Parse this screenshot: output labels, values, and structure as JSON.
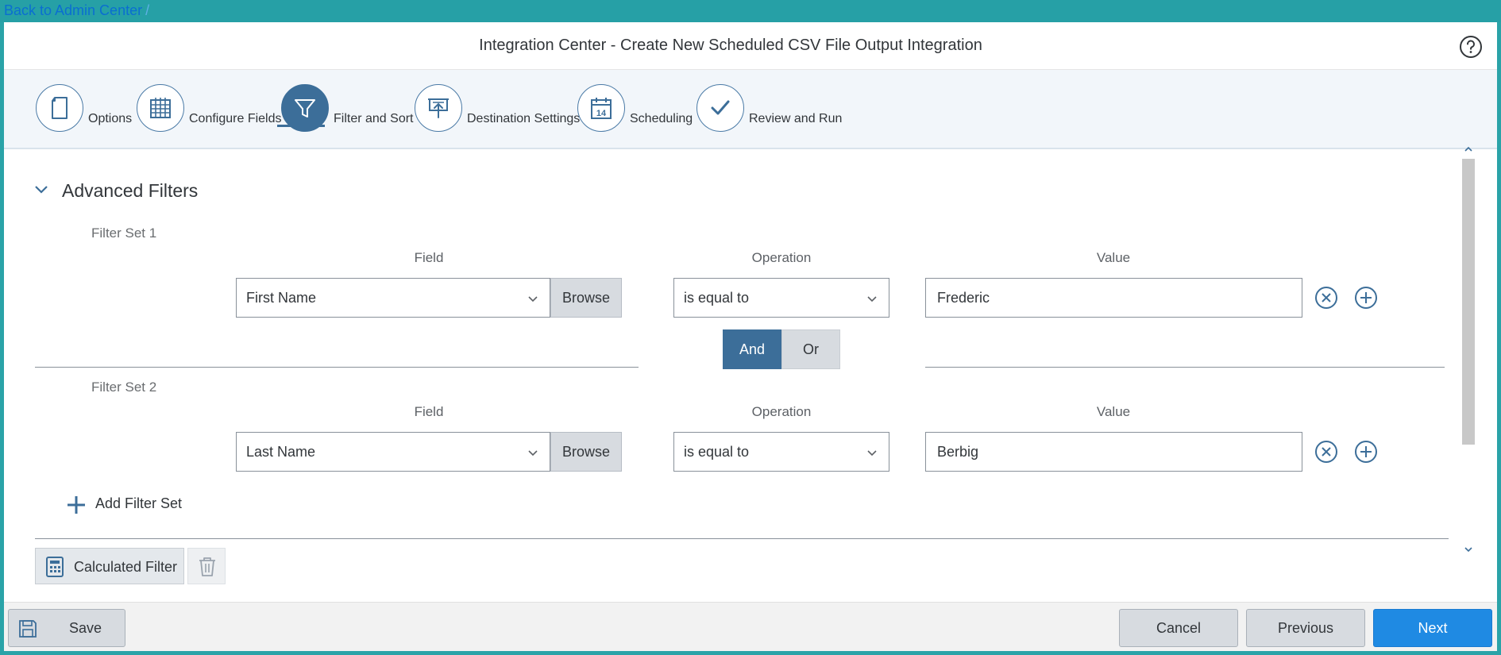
{
  "breadcrumb": {
    "back_label": "Back to Admin Center",
    "separator": "/"
  },
  "header": {
    "title": "Integration Center - Create New Scheduled CSV File Output Integration"
  },
  "steps": [
    {
      "label": "Options",
      "icon": "document-icon",
      "active": false
    },
    {
      "label": "Configure Fields",
      "icon": "table-grid-icon",
      "active": false
    },
    {
      "label": "Filter and Sort",
      "icon": "filter-funnel-icon",
      "active": true
    },
    {
      "label": "Destination Settings",
      "icon": "presentation-upload-icon",
      "active": false
    },
    {
      "label": "Scheduling",
      "icon": "calendar-icon",
      "active": false
    },
    {
      "label": "Review and Run",
      "icon": "checkmark-icon",
      "active": false
    }
  ],
  "calendar_day": "14",
  "section": {
    "title": "Advanced Filters"
  },
  "filter_sets": [
    {
      "label": "Filter Set 1",
      "field_header": "Field",
      "operation_header": "Operation",
      "value_header": "Value",
      "field": "First Name",
      "browse_label": "Browse",
      "operation": "is equal to",
      "value": "Frederic"
    },
    {
      "label": "Filter Set 2",
      "field_header": "Field",
      "operation_header": "Operation",
      "value_header": "Value",
      "field": "Last Name",
      "browse_label": "Browse",
      "operation": "is equal to",
      "value": "Berbig"
    }
  ],
  "logic_toggle": {
    "and_label": "And",
    "or_label": "Or",
    "selected": "And"
  },
  "add_filter_set_label": "Add Filter Set",
  "calculated_filter_label": "Calculated Filter",
  "footer": {
    "save_label": "Save",
    "cancel_label": "Cancel",
    "previous_label": "Previous",
    "next_label": "Next"
  },
  "colors": {
    "accent": "#3c6e99",
    "primary_button": "#1f8ae3",
    "top_bar": "#26a0a6"
  }
}
